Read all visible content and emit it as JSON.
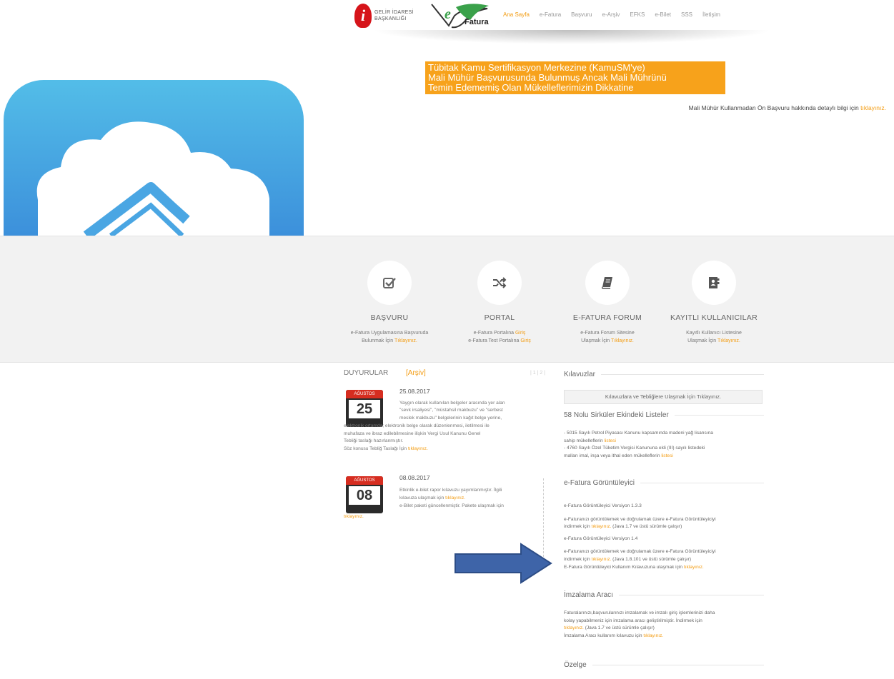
{
  "header": {
    "gib_logo_letter": "i",
    "gib_logo_line1": "GELİR İDARESİ",
    "gib_logo_line2": "BAŞKANLIĞI",
    "efatura_logo_e": "e",
    "efatura_logo_text": "Fatura",
    "nav": [
      "Ana Sayfa",
      "e-Fatura",
      "Başvuru",
      "e-Arşiv",
      "EFKS",
      "e-Bilet",
      "SSS",
      "İletişim"
    ],
    "nav_active_index": 0
  },
  "notice": {
    "line1": "Tübitak Kamu Sertifikasyon Merkezine (KamuSM'ye)",
    "line2": "Mali Mühür Başvurusunda Bulunmuş Ancak Mali Mührünü",
    "line3": "Temin Edememiş Olan Mükelleflerimizin Dikkatine"
  },
  "mali_line": {
    "text": "Mali Mühür Kullanmadan Ön Başvuru hakkında detaylı bilgi için ",
    "link": "tıklayınız."
  },
  "features": [
    {
      "icon": "checkbox-icon",
      "title": "BAŞVURU",
      "desc1": "e-Fatura Uygulamasına Başvuruda",
      "desc2_pre": "Bulunmak İçin ",
      "desc2_link": "Tıklayınız."
    },
    {
      "icon": "shuffle-icon",
      "title": "PORTAL",
      "desc1_pre": "e-Fatura Portalına ",
      "desc1_link": "Giriş",
      "desc2_pre": "e-Fatura Test Portalına ",
      "desc2_link": "Giriş"
    },
    {
      "icon": "book-icon",
      "title": "E-FATURA FORUM",
      "desc1": "e-Fatura Forum Sitesine",
      "desc2_pre": "Ulaşmak İçin ",
      "desc2_link": "Tıklayınız."
    },
    {
      "icon": "contacts-book-icon",
      "title": "KAYITLI KULLANICILAR",
      "desc1": "Kayıtlı Kullanıcı Listesine",
      "desc2_pre": "Ulaşmak İçin ",
      "desc2_link": "Tıklayınız."
    }
  ],
  "announcements": {
    "title": "DUYURULAR",
    "archive": "[Arşiv]",
    "pager": "| 1 | 2 |",
    "items": [
      {
        "month": "AĞUSTOS",
        "day": "25",
        "date": "25.08.2017",
        "lines": [
          "Yaygın olarak kullanılan belgeler arasında yer alan",
          "\"sevk irsaliyesi\", \"müstahsil makbuzu\" ve \"serbest",
          "meslek makbuzu\" belgelerinin kağıt belge yerine,",
          "elektronik ortamda; elektronik belge olarak düzenlenmesi, iletilmesi ile",
          "muhafaza ve ibraz edilebilmesine ilişkin Vergi Usul Kanunu Genel",
          "Tebliği taslağı hazırlanmıştır."
        ],
        "last_pre": "Söz konusu Tebliğ Taslağı İçin ",
        "last_link": "tıklayınız."
      },
      {
        "month": "AĞUSTOS",
        "day": "08",
        "date": "08.08.2017",
        "line1": "Etkinlik e-bilet rapor kılavuzu yayımlanmıştır. İlgili",
        "line2_pre": "kılavuza ulaşmak için ",
        "line2_link": "tıklayınız.",
        "line3": "e-Bilet paketi güncellenmiştir. Pakete ulaşmak için",
        "line4_link": "tıklayınız."
      }
    ]
  },
  "right": {
    "kilavuzlar_title": "Kılavuzlar",
    "kilavuzlar_button": "Kılavuzlara ve Tebliğlere Ulaşmak İçin Tıklayınız.",
    "sirkuler_title": "58 Nolu Sirküler Ekindeki Listeler",
    "sirkuler_1": "- 5015 Sayılı Petrol Piyasası Kanunu kapsamında madeni yağ lisansına",
    "sirkuler_1b_pre": "sahip mükelleflerin ",
    "sirkuler_1b_link": "listesi",
    "sirkuler_2": "- 4760 Sayılı Özel Tüketim Vergisi Kanununa ekli (III) sayılı listedeki",
    "sirkuler_2b_pre": "malları imal, inşa veya ithal eden mükelleflerin ",
    "sirkuler_2b_link": "listesi",
    "goruntuleyici_title": "e-Fatura Görüntüleyici",
    "v133": "e-Fatura Görüntüleyici Versiyon 1.3.3",
    "v133_desc": "e-Faturanızı görüntülemek ve doğrulamak üzere e-Fatura Görüntüleyiciyi",
    "v133_desc2_pre": "indirmek için ",
    "v133_desc2_link": "tıklayınız.",
    "v133_desc2_post": " (Java 1.7 ve üstü sürümle çalışır)",
    "v14": "e-Fatura Görüntüleyici Versiyon 1.4",
    "v14_desc": "e-Faturanızı görüntülemek ve doğrulamak üzere e-Fatura Görüntüleyiciyi",
    "v14_desc2_pre": "indirmek için ",
    "v14_desc2_link": "tıklayınız.",
    "v14_desc2_post": " (Java 1.8.101 ve üstü sürümle çalışır)",
    "v14_desc3_pre": "E-Fatura Görüntüleyici Kullanım Kılavuzuna ulaşmak için ",
    "v14_desc3_link": "tıklayınız.",
    "imzalama_title": "İmzalama Aracı",
    "imz_1": "Faturalarınızı,başvurularınızı imzalamak ve imzalı giriş işlemlerinizi daha",
    "imz_2": "kolay yapabilmeniz için imzalama aracı geliştirilmiştir. İndirmek için",
    "imz_3_link": "tıklayınız.",
    "imz_3_post": " (Java 1.7 ve üstü sürümle çalışır)",
    "imz_4_pre": "İmzalama Aracı kullanım kılavuzu için ",
    "imz_4_link": "tıklayınız.",
    "ozelge_title": "Özelge"
  },
  "colors": {
    "accent": "#f39c12",
    "notice_bg": "#f7a21b",
    "arrow": "#3e64a8",
    "cloud_blue": "#4aa6e3",
    "calendar_red": "#d62d20"
  }
}
